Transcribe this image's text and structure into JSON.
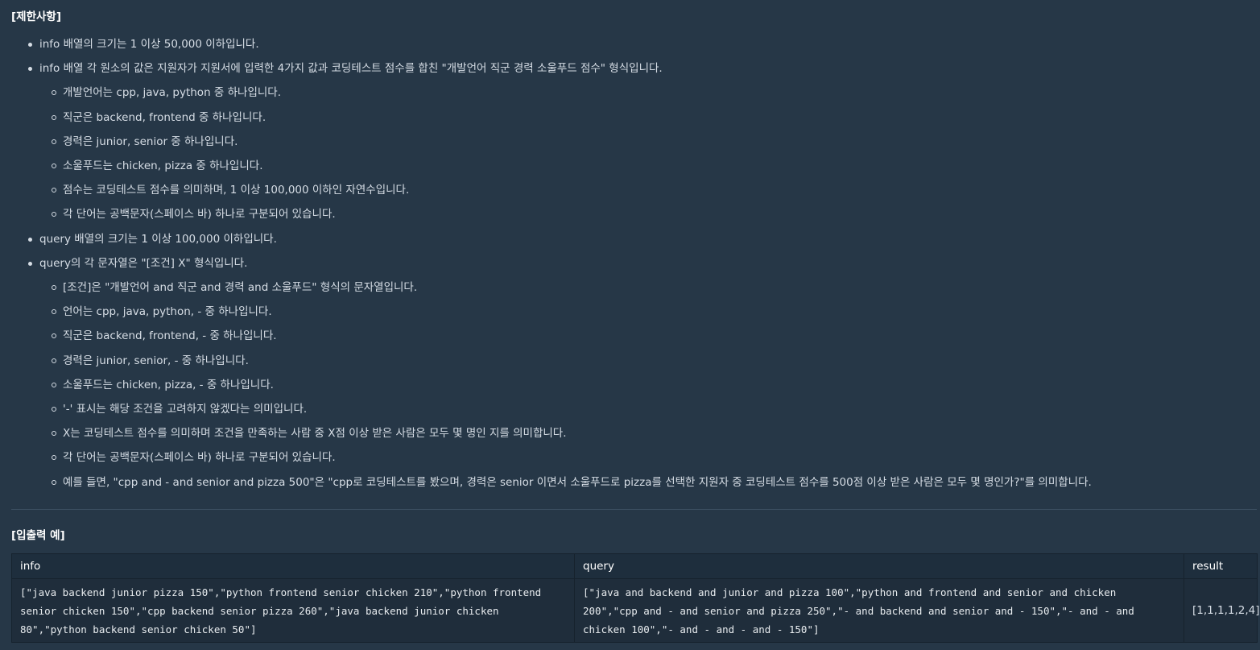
{
  "constraints": {
    "heading": "[제한사항]",
    "items": [
      {
        "text": "info 배열의 크기는 1 이상 50,000 이하입니다.",
        "sub": []
      },
      {
        "text": "info 배열 각 원소의 값은 지원자가 지원서에 입력한 4가지 값과 코딩테스트 점수를 합친 \"개발언어 직군 경력 소울푸드 점수\" 형식입니다.",
        "sub": [
          "개발언어는 cpp, java, python 중 하나입니다.",
          "직군은 backend, frontend 중 하나입니다.",
          "경력은 junior, senior 중 하나입니다.",
          "소울푸드는 chicken, pizza 중 하나입니다.",
          "점수는 코딩테스트 점수를 의미하며, 1 이상 100,000 이하인 자연수입니다.",
          "각 단어는 공백문자(스페이스 바) 하나로 구분되어 있습니다."
        ]
      },
      {
        "text": "query 배열의 크기는 1 이상 100,000 이하입니다.",
        "sub": []
      },
      {
        "text": "query의 각 문자열은 \"[조건] X\" 형식입니다.",
        "sub": [
          "[조건]은 \"개발언어 and 직군 and 경력 and 소울푸드\" 형식의 문자열입니다.",
          "언어는 cpp, java, python, - 중 하나입니다.",
          "직군은 backend, frontend, - 중 하나입니다.",
          "경력은 junior, senior, - 중 하나입니다.",
          "소울푸드는 chicken, pizza, - 중 하나입니다.",
          "'-' 표시는 해당 조건을 고려하지 않겠다는 의미입니다.",
          "X는 코딩테스트 점수를 의미하며 조건을 만족하는 사람 중 X점 이상 받은 사람은 모두 몇 명인 지를 의미합니다.",
          "각 단어는 공백문자(스페이스 바) 하나로 구분되어 있습니다.",
          "예를 들면, \"cpp and - and senior and pizza 500\"은 \"cpp로 코딩테스트를 봤으며, 경력은 senior 이면서 소울푸드로 pizza를 선택한 지원자 중 코딩테스트 점수를 500점 이상 받은 사람은 모두 몇 명인가?\"를 의미합니다."
        ]
      }
    ]
  },
  "io": {
    "heading": "[입출력 예]",
    "columns": [
      "info",
      "query",
      "result"
    ],
    "row": {
      "info_lines": [
        "[\"java backend junior pizza 150\",\"python frontend senior chicken 210\",\"python frontend",
        "senior chicken 150\",\"cpp backend senior pizza 260\",\"java backend junior chicken",
        "80\",\"python backend senior chicken 50\"]"
      ],
      "query_lines": [
        "[\"java and backend and junior and pizza 100\",\"python and frontend and senior and chicken",
        "200\",\"cpp and - and senior and pizza 250\",\"- and backend and senior and - 150\",\"- and - and",
        "chicken 100\",\"- and - and - and - 150\"]"
      ],
      "result": "[1,1,1,1,2,4]"
    }
  }
}
